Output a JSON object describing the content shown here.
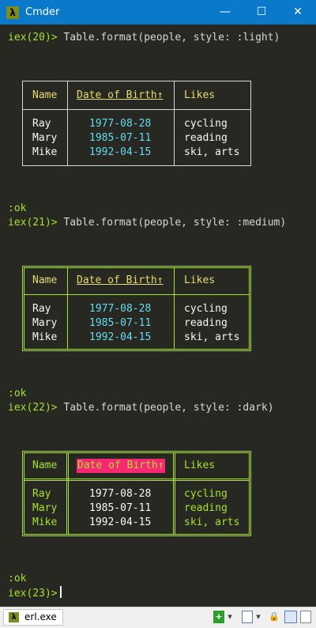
{
  "window": {
    "title": "Cmder",
    "app_icon": "λ",
    "minimize_glyph": "—",
    "maximize_glyph": "☐",
    "close_glyph": "✕"
  },
  "terminal": {
    "prompt1": "iex(20)>",
    "cmd1": " Table.format(people, style: :light)",
    "ok1": ":ok",
    "prompt2": "iex(21)>",
    "cmd2": " Table.format(people, style: :medium)",
    "ok2": ":ok",
    "prompt3": "iex(22)>",
    "cmd3": " Table.format(people, style: :dark)",
    "ok3": ":ok",
    "prompt4": "iex(23)>",
    "headers": [
      "Name",
      "Date of Birth↑",
      "Likes"
    ],
    "rows": [
      [
        "Ray",
        "1977-08-28",
        "cycling"
      ],
      [
        "Mary",
        "1985-07-11",
        "reading"
      ],
      [
        "Mike",
        "1992-04-15",
        "ski, arts"
      ]
    ]
  },
  "statusbar": {
    "tab_icon": "λ",
    "tab_label": "erl.exe",
    "new_console_glyph": "+",
    "dropdown_glyph": "▾",
    "lock_glyph": "🔒",
    "colors": {
      "brand": "#0a79c9",
      "accent": "#a6e22e",
      "highlight": "#f92672",
      "info": "#66d9ef"
    }
  }
}
